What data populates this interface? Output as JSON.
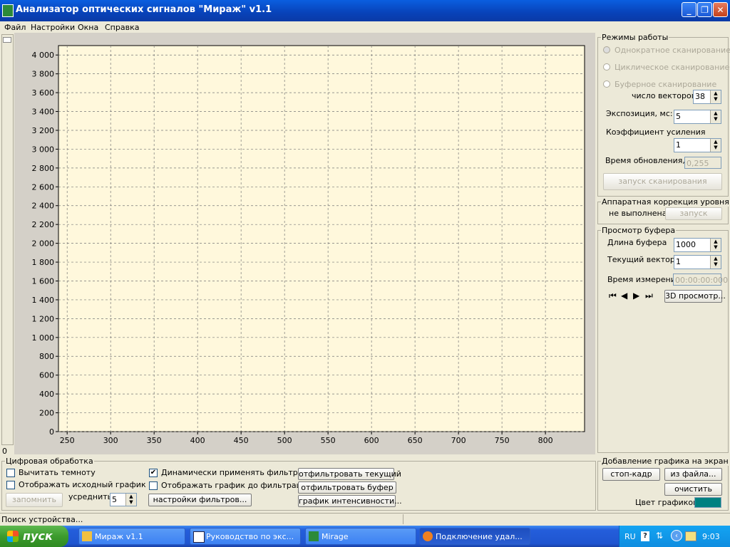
{
  "window": {
    "title": "Анализатор оптических сигналов \"Мираж\" v1.1",
    "buttons": {
      "minimize": "_",
      "maximize": "❐",
      "close": "✕"
    }
  },
  "menu": [
    "Файл",
    "Настройки",
    "Окна",
    "Справка"
  ],
  "slider": {
    "bottom_value": "0"
  },
  "chart_data": {
    "type": "line",
    "xlabel": "",
    "ylabel": "",
    "xlim": [
      240,
      845
    ],
    "ylim": [
      0,
      4100
    ],
    "x_ticks": [
      "250",
      "300",
      "350",
      "400",
      "450",
      "500",
      "550",
      "600",
      "650",
      "700",
      "750",
      "800"
    ],
    "y_ticks": [
      "0",
      "200",
      "400",
      "600",
      "800",
      "1 000",
      "1 200",
      "1 400",
      "1 600",
      "1 800",
      "2 000",
      "2 200",
      "2 400",
      "2 600",
      "2 800",
      "3 000",
      "3 200",
      "3 400",
      "3 600",
      "3 800",
      "4 000"
    ],
    "series": [],
    "grid": true,
    "background": "#fff8dc"
  },
  "modes": {
    "title": "Режимы работы",
    "single": "Однократное сканирование",
    "cyclic": "Циклическое сканирование",
    "buffer": "Буферное сканирование",
    "vectors_label": "число векторов",
    "vectors_value": "38",
    "exposure_label": "Экспозиция, мс:",
    "exposure_value": "5",
    "gain_label": "Коэффициент усиления",
    "gain_value": "1",
    "refresh_label": "Время обновления, с",
    "refresh_value": "0,255",
    "scan_button": "запуск сканирования"
  },
  "hwcorr": {
    "title": "Аппаратная коррекция уровня",
    "status": "не выполнена",
    "button": "запуск"
  },
  "buffer_view": {
    "title": "Просмотр буфера",
    "length_label": "Длина буфера",
    "length_value": "1000",
    "current_label": "Текущий вектор",
    "current_value": "1",
    "time_label": "Время измерения",
    "time_value": "00:00:00:000",
    "view3d_button": "3D просмотр..."
  },
  "digital": {
    "title": "Цифровая обработка",
    "subtract_dark": "Вычитать темноту",
    "show_source": "Отображать исходный график",
    "remember_button": "запомнить",
    "average_label": "усреднить",
    "average_value": "5",
    "dynamic_filters": "Динамически применять фильтры",
    "show_before_filter": "Отображать график до фильтрации",
    "filter_settings_button": "настройки фильтров...",
    "filter_current_button": "отфильтровать текущий",
    "filter_buffer_button": "отфильтровать буфер",
    "intensity_button": "график интенсивности..."
  },
  "add_graph": {
    "title": "Добавление графика на экран",
    "freeze_button": "стоп-кадр",
    "from_file_button": "из файла...",
    "clear_button": "очистить",
    "color_label": "Цвет графиков",
    "color": "#008080"
  },
  "status": {
    "text": "Поиск устройства..."
  },
  "taskbar": {
    "start": "пуск",
    "tasks": [
      "Мираж v1.1",
      "Руководство по экс...",
      "Mirage",
      "Подключение удал..."
    ],
    "lang": "RU",
    "clock": "9:03"
  }
}
